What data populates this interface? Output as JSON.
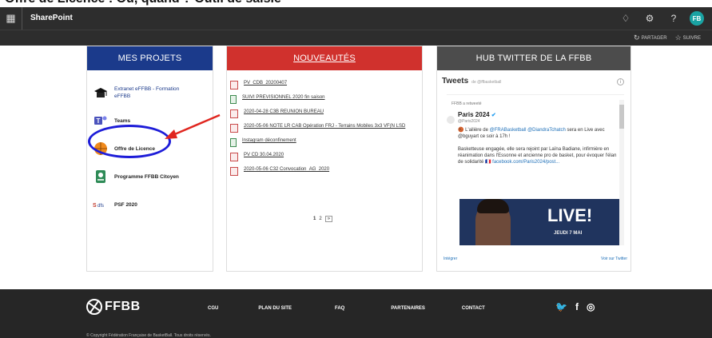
{
  "caption": "Offre de Licence : Où, quand ? Outil de saisie",
  "suitebar": {
    "app_title": "SharePoint",
    "waffle_icon": "app-launcher-icon",
    "avatar_initials": "FB"
  },
  "command_bar": {
    "share_label": "PARTAGER",
    "follow_label": "SUIVRE"
  },
  "projects": {
    "title": "MES PROJETS",
    "items": [
      {
        "label": "Extranet eFFBB - Formation eFFBB",
        "icon": "graduation-cap-icon"
      },
      {
        "label": "Teams",
        "icon": "teams-icon"
      },
      {
        "label": "Offre de Licence",
        "icon": "basketball-icon"
      },
      {
        "label": "Programme FFBB Citoyen",
        "icon": "citizen-badge-icon"
      },
      {
        "label": "PSF 2020",
        "icon": "psf-logo-icon"
      }
    ]
  },
  "news": {
    "title": "NOUVEAUTÉS",
    "items": [
      {
        "label": "PV_CDB_20200407",
        "type": "pdf"
      },
      {
        "label": "SUIVI PREVISIONNEL 2020 fin saison",
        "type": "doc"
      },
      {
        "label": "2020-04-28 C3B REUNION BUREAU",
        "type": "pdf"
      },
      {
        "label": "2020-05-06 NOTE LR CAB Opération FRJ - Terrains Mobiles 3x3 VF(N LSD",
        "type": "pdf"
      },
      {
        "label": "Instagram déconfinement",
        "type": "doc"
      },
      {
        "label": "PV CD 30.04.2020",
        "type": "pdf"
      },
      {
        "label": "2020-05-06 C32 Convocation_AG_2020",
        "type": "pdf"
      }
    ],
    "pager": {
      "current": "1",
      "next": "2",
      "next_arrow": "»"
    }
  },
  "twitter": {
    "title": "HUB TWITTER DE LA FFBB",
    "timeline_title": "Tweets",
    "timeline_by": "de @ffbasketball",
    "retweet_note": "FFBB a retweeté",
    "author_name": "Paris 2024",
    "author_handle": "@Paris2024",
    "tweet_p1_start": "🏀 L'ailière de ",
    "tweet_p1_link1": "@FRABasketball",
    "tweet_p1_mid": " ",
    "tweet_p1_link2": "@DiandraTchatch",
    "tweet_p1_end": " sera en Live avec @bguyart ce soir à 17h !",
    "tweet_p2_start": "Basketteuse engagée, elle sera rejoint par Laïna Badiane, infirmière en réanimation dans l'Essonne et ancienne pro de basket, pour évoquer l'élan de solidarité 🇫🇷 ",
    "tweet_p2_link": "facebook.com/Paris2024/post...",
    "media_live": "LIVE!",
    "media_date": "JEUDI 7 MAI",
    "embed_label": "Intégrer",
    "view_on_twitter": "Voir sur Twitter"
  },
  "footer": {
    "logo_text": "FFBB",
    "links": [
      "CGU",
      "PLAN DU SITE",
      "FAQ",
      "PARTENAIRES",
      "CONTACT"
    ],
    "social": [
      "twitter-icon",
      "facebook-icon",
      "instagram-icon"
    ],
    "copyright": "© Copyright Fédération Française de BasketBall. Tous droits réservés."
  }
}
